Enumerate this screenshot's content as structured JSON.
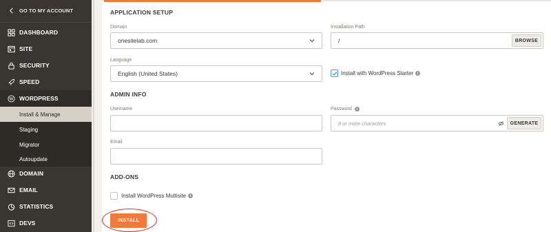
{
  "sidebar": {
    "back_label": "GO TO MY ACCOUNT",
    "items": [
      {
        "label": "DASHBOARD",
        "icon": "dashboard-icon"
      },
      {
        "label": "SITE",
        "icon": "site-icon"
      },
      {
        "label": "SECURITY",
        "icon": "lock-icon"
      },
      {
        "label": "SPEED",
        "icon": "rocket-icon"
      },
      {
        "label": "WORDPRESS",
        "icon": "wordpress-icon"
      },
      {
        "label": "DOMAIN",
        "icon": "globe-icon"
      },
      {
        "label": "EMAIL",
        "icon": "mail-icon"
      },
      {
        "label": "STATISTICS",
        "icon": "pie-chart-icon"
      },
      {
        "label": "DEVS",
        "icon": "code-icon"
      }
    ],
    "wordpress_sub": [
      {
        "label": "Install & Manage",
        "active": true
      },
      {
        "label": "Staging"
      },
      {
        "label": "Migrator"
      },
      {
        "label": "Autoupdate"
      }
    ]
  },
  "application_setup": {
    "title": "APPLICATION SETUP",
    "domain_label": "Domain",
    "domain_value": "onesitelab.com",
    "path_label": "Installation Path",
    "path_value": "/",
    "browse_label": "BROWSE",
    "language_label": "Language",
    "language_value": "English (United States)",
    "starter_label": "Install with WordPress Starter",
    "starter_checked": true
  },
  "admin_info": {
    "title": "ADMIN INFO",
    "username_label": "Username",
    "username_value": "",
    "password_label": "Password",
    "password_placeholder": "8 or more characters",
    "generate_label": "GENERATE",
    "email_label": "Email",
    "email_value": ""
  },
  "addons": {
    "title": "ADD-ONS",
    "multisite_label": "Install WordPress Multisite",
    "multisite_checked": false
  },
  "install_label": "INSTALL",
  "colors": {
    "accent": "#ee7a3b",
    "sidebar_bg": "#393531",
    "active_sub_bg": "#d6d0c6",
    "check_color": "#4aa3b5",
    "annotation_ring": "#e02020"
  }
}
